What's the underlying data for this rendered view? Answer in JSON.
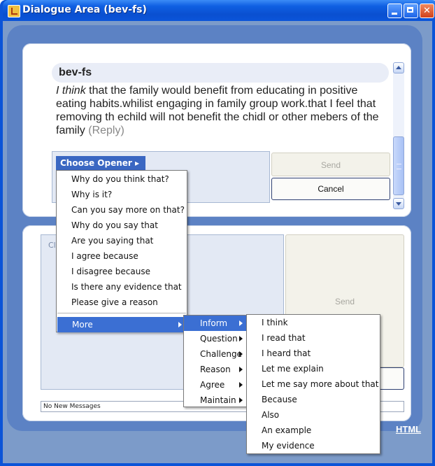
{
  "window": {
    "title": "Dialogue Area (bev-fs)"
  },
  "message": {
    "author": "bev-fs",
    "opener": "I think",
    "body": " that the family would benefit from educating in positive eating habits.whilist engaging in family group work.that I feel that removing th echild will not benefit the chidl or other mebers of the family ",
    "reply_label": "(Reply)"
  },
  "composer_top": {
    "choose_opener": "Choose Opener ▸",
    "send": "Send",
    "cancel": "Cancel"
  },
  "composer_bottom": {
    "placeholder_fragment": "Cl",
    "send": "Send"
  },
  "status": {
    "text": "No New Messages"
  },
  "footer": {
    "link_fragment": "HTML"
  },
  "opener_menu": {
    "items": [
      "Why do you think that?",
      "Why is it?",
      "Can you say more on that?",
      "Why do you say that",
      "Are you saying that",
      "I agree because",
      "I disagree because",
      "Is there any evidence that",
      "Please give a reason"
    ],
    "more": "More"
  },
  "more_menu": {
    "items": [
      "Inform",
      "Question",
      "Challenge",
      "Reason",
      "Agree",
      "Maintain"
    ],
    "highlighted": "Inform"
  },
  "inform_menu": {
    "items": [
      "I think",
      "I read that",
      "I heard that",
      "Let me explain",
      "Let me say more about that",
      "Because",
      "Also",
      "An example",
      "My evidence"
    ]
  },
  "colors": {
    "titlebar": "#0a4fd0",
    "menu_highlight": "#3b6fd3",
    "panel_bg": "#5c82c4"
  }
}
